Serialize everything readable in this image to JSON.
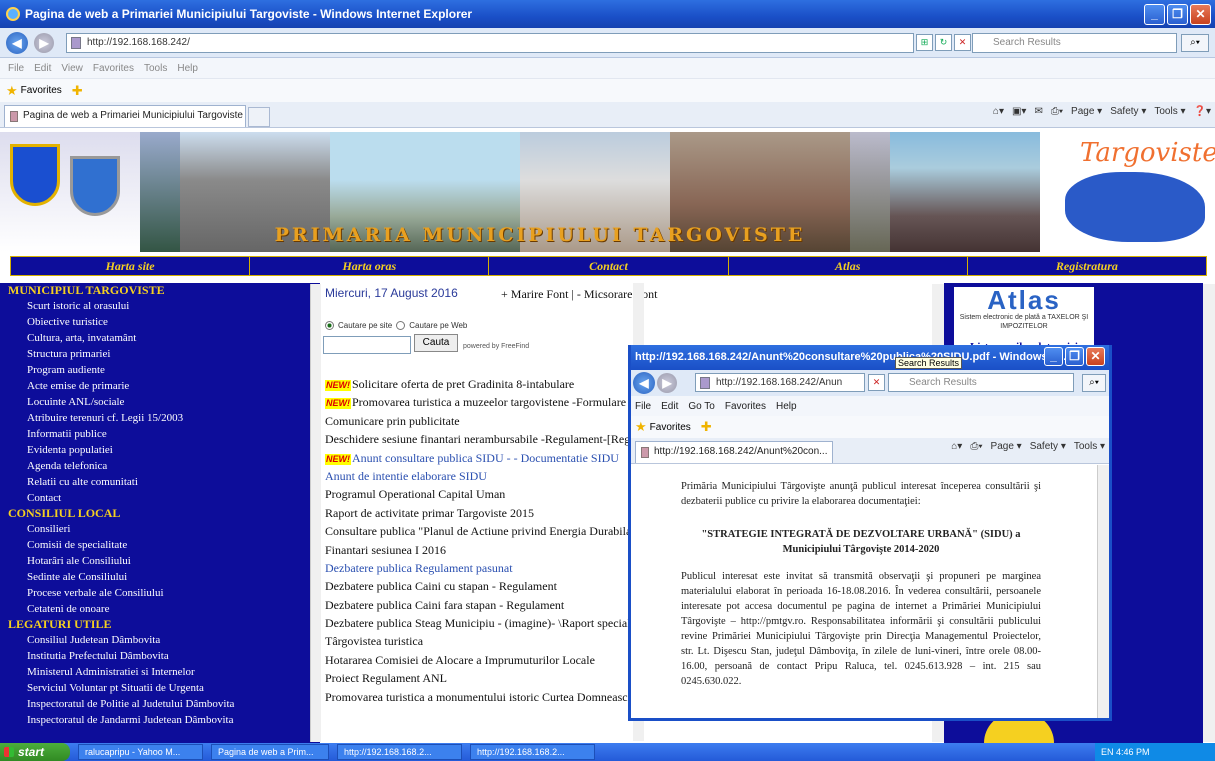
{
  "window": {
    "title": "Pagina de web a Primariei Municipiului Targoviste - Windows Internet Explorer"
  },
  "address": {
    "url": "http://192.168.168.242/",
    "search_placeholder": "Search Results"
  },
  "menu": [
    "File",
    "Edit",
    "View",
    "Favorites",
    "Tools",
    "Help"
  ],
  "favorites_label": "Favorites",
  "tab_title": "Pagina de web a Primariei Municipiului Targoviste",
  "commands": {
    "page": "Page ▾",
    "safety": "Safety ▾",
    "tools": "Tools ▾"
  },
  "banner": {
    "title": "PRIMARIA MUNICIPIULUI TARGOVISTE",
    "map_text": "Targoviste"
  },
  "nav": [
    "Harta site",
    "Harta oras",
    "Contact",
    "Atlas",
    "Registratura"
  ],
  "sidebar": {
    "sections": [
      {
        "heading": "MUNICIPIUL TARGOVISTE",
        "items": [
          "Scurt istoric al orasului",
          "Obiective turistice",
          "Cultura, arta, invatamânt",
          "Structura primariei",
          "Program audiente",
          "Acte emise de primarie",
          "Locuinte ANL/sociale",
          "Atribuire terenuri cf. Legii 15/2003",
          "Informatii publice",
          "Evidenta populatiei",
          "Agenda telefonica",
          "Relatii cu alte comunitati",
          "Contact"
        ]
      },
      {
        "heading": "CONSILIUL LOCAL",
        "items": [
          "Consilieri",
          "Comisii de specialitate",
          "Hotarâri ale Consiliului",
          "Sedinte ale Consiliului",
          "Procese verbale ale Consiliului",
          "Cetateni de onoare"
        ]
      },
      {
        "heading": "LEGATURI UTILE",
        "items": [
          "Consiliul Judetean Dâmbovita",
          "Institutia Prefectului Dâmbovita",
          "Ministerul Administratiei si Internelor",
          "Serviciul Voluntar pt Situatii de Urgenta",
          "Inspectoratul de Politie al Judetului Dâmbovita",
          "Inspectoratul de Jandarmi Judetean Dâmbovita"
        ]
      }
    ]
  },
  "center": {
    "date": "Miercuri, 17 August 2016",
    "font_controls": "+ Marire Font | - Micsorare Font",
    "radio_site": "Cautare pe site",
    "radio_web": "Cautare pe Web",
    "search_button": "Cauta",
    "powered": "powered by FreeFind",
    "new_badge": "NEW!",
    "news": [
      {
        "text": "Solicitare oferta de pret Gradinita 8-intabulare",
        "new": true,
        "link": false
      },
      {
        "text": "Promovarea turistica a muzeelor targovistene -Formulare -1.",
        "new": true,
        "link": false
      },
      {
        "text": "Comunicare prin publicitate",
        "new": false,
        "link": false
      },
      {
        "text": "Deschidere sesiune finantari nerambursabile -Regulament-[Regular",
        "new": false,
        "link": false
      },
      {
        "text": "Anunt consultare publica SIDU - - Documentatie SIDU",
        "new": true,
        "link": true
      },
      {
        "text": "Anunt de intentie elaborare SIDU",
        "new": false,
        "link": true
      },
      {
        "text": "Programul Operational Capital Uman",
        "new": false,
        "link": false
      },
      {
        "text": "Raport de activitate primar Targoviste 2015",
        "new": false,
        "link": false
      },
      {
        "text": "Consultare publica \"Planul de Actiune privind Energia Durabila\"",
        "new": false,
        "link": false
      },
      {
        "text": "Finantari sesiunea I 2016",
        "new": false,
        "link": false
      },
      {
        "text": "Dezbatere publica Regulament pasunat",
        "new": false,
        "link": true
      },
      {
        "text": "Dezbatere publica Caini cu stapan - Regulament",
        "new": false,
        "link": false
      },
      {
        "text": "Dezbatere publica Caini fara stapan - Regulament",
        "new": false,
        "link": false
      },
      {
        "text": "Dezbatere publica Steag Municipiu - (imagine)- \\Raport specialitat",
        "new": false,
        "link": false
      },
      {
        "text": "Târgovistea turistica",
        "new": false,
        "link": false
      },
      {
        "text": "Hotararea Comisiei de Alocare a Imprumuturilor Locale",
        "new": false,
        "link": false
      },
      {
        "text": "Proiect Regulament ANL",
        "new": false,
        "link": false
      },
      {
        "text": "Promovarea turistica a monumentului istoric Curtea Domneasca di",
        "new": false,
        "link": false
      }
    ]
  },
  "right": {
    "atlas": "Atlas",
    "atlas_sub": "Sistem electronic de plată a TAXELOR ŞI IMPOZITELOR",
    "lista": "Lista marilor datornici"
  },
  "popup": {
    "title": "http://192.168.168.242/Anunt%20consultare%20publica%20SIDU.pdf - Windows In...",
    "url": "http://192.168.168.242/Anun",
    "search": "Search Results",
    "menu": [
      "File",
      "Edit",
      "Go To",
      "Favorites",
      "Help"
    ],
    "favorites": "Favorites",
    "tab": "http://192.168.168.242/Anunt%20con...",
    "para1": "Primăria Municipiului Târgovişte anunţă publicul interesat începerea consultării şi dezbaterii publice cu privire la elaborarea documentaţiei:",
    "heading": "\"STRATEGIE INTEGRATĂ DE DEZVOLTARE URBANĂ\" (SIDU) a Municipiului Târgovişte 2014-2020",
    "para2": "Publicul interesat este invitat să transmită observaţii şi propuneri pe marginea materialului elaborat în perioada 16-18.08.2016. În vederea consultării, persoanele interesate pot accesa documentul pe pagina de internet a Primăriei Municipiului Târgovişte – http://pmtgv.ro. Responsabilitatea informării şi consultării publicului revine Primăriei Municipiului Târgovişte prin Direcţia Managementul Proiectelor, str. Lt. Dişescu Stan, judeţul Dâmboviţa, în zilele de luni-vineri, între orele 08.00-16.00, persoană de contact Pripu Raluca, tel. 0245.613.928 – int. 215 sau 0245.630.022."
  },
  "tooltip": "Search Results",
  "taskbar": {
    "start": "start",
    "tasks": [
      "ralucapripu - Yahoo M...",
      "Pagina de web a Prim...",
      "http://192.168.168.2...",
      "http://192.168.168.2..."
    ],
    "tray": "EN   4:46 PM"
  }
}
